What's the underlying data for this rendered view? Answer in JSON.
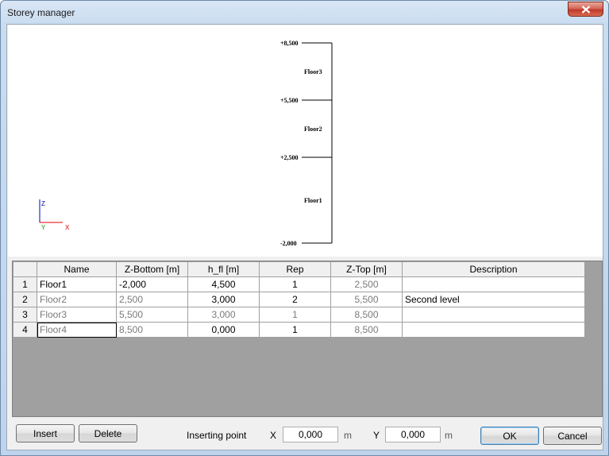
{
  "window": {
    "title": "Storey manager"
  },
  "preview": {
    "axis": {
      "z": "Z",
      "x": "X",
      "y": "Y"
    },
    "levels": [
      {
        "label": "+8,500",
        "z": 8.5
      },
      {
        "label": "+5,500",
        "z": 5.5
      },
      {
        "label": "+2,500",
        "z": 2.5
      },
      {
        "label": "-2,000",
        "z": -2.0
      }
    ],
    "floors": [
      {
        "label": "Floor3",
        "z_mid": 7.0
      },
      {
        "label": "Floor2",
        "z_mid": 4.0
      },
      {
        "label": "Floor1",
        "z_mid": 0.25
      }
    ]
  },
  "table": {
    "headers": [
      "",
      "Name",
      "Z-Bottom [m]",
      "h_fl [m]",
      "Rep",
      "Z-Top [m]",
      "Description"
    ],
    "rows": [
      {
        "num": "1",
        "name": "Floor1",
        "z_bottom": "-2,000",
        "h_fl": "4,500",
        "rep": "1",
        "z_top": "2,500",
        "description": ""
      },
      {
        "num": "2",
        "name": "Floor2",
        "z_bottom": "2,500",
        "h_fl": "3,000",
        "rep": "2",
        "z_top": "5,500",
        "description": "Second level"
      },
      {
        "num": "3",
        "name": "Floor3",
        "z_bottom": "5,500",
        "h_fl": "3,000",
        "rep": "1",
        "z_top": "8,500",
        "description": ""
      },
      {
        "num": "4",
        "name": "Floor4",
        "z_bottom": "8,500",
        "h_fl": "0,000",
        "rep": "1",
        "z_top": "8,500",
        "description": ""
      }
    ]
  },
  "footer": {
    "insert_label": "Insert",
    "delete_label": "Delete",
    "inserting_point_label": "Inserting point",
    "x_label": "X",
    "x_value": "0,000",
    "x_unit": "m",
    "y_label": "Y",
    "y_value": "0,000",
    "y_unit": "m",
    "ok_label": "OK",
    "cancel_label": "Cancel"
  },
  "colors": {
    "axis_x": "#e00000",
    "axis_y": "#00a000",
    "axis_z": "#0000c0",
    "titlebar": "#c9dcf0",
    "close": "#c0392b"
  }
}
